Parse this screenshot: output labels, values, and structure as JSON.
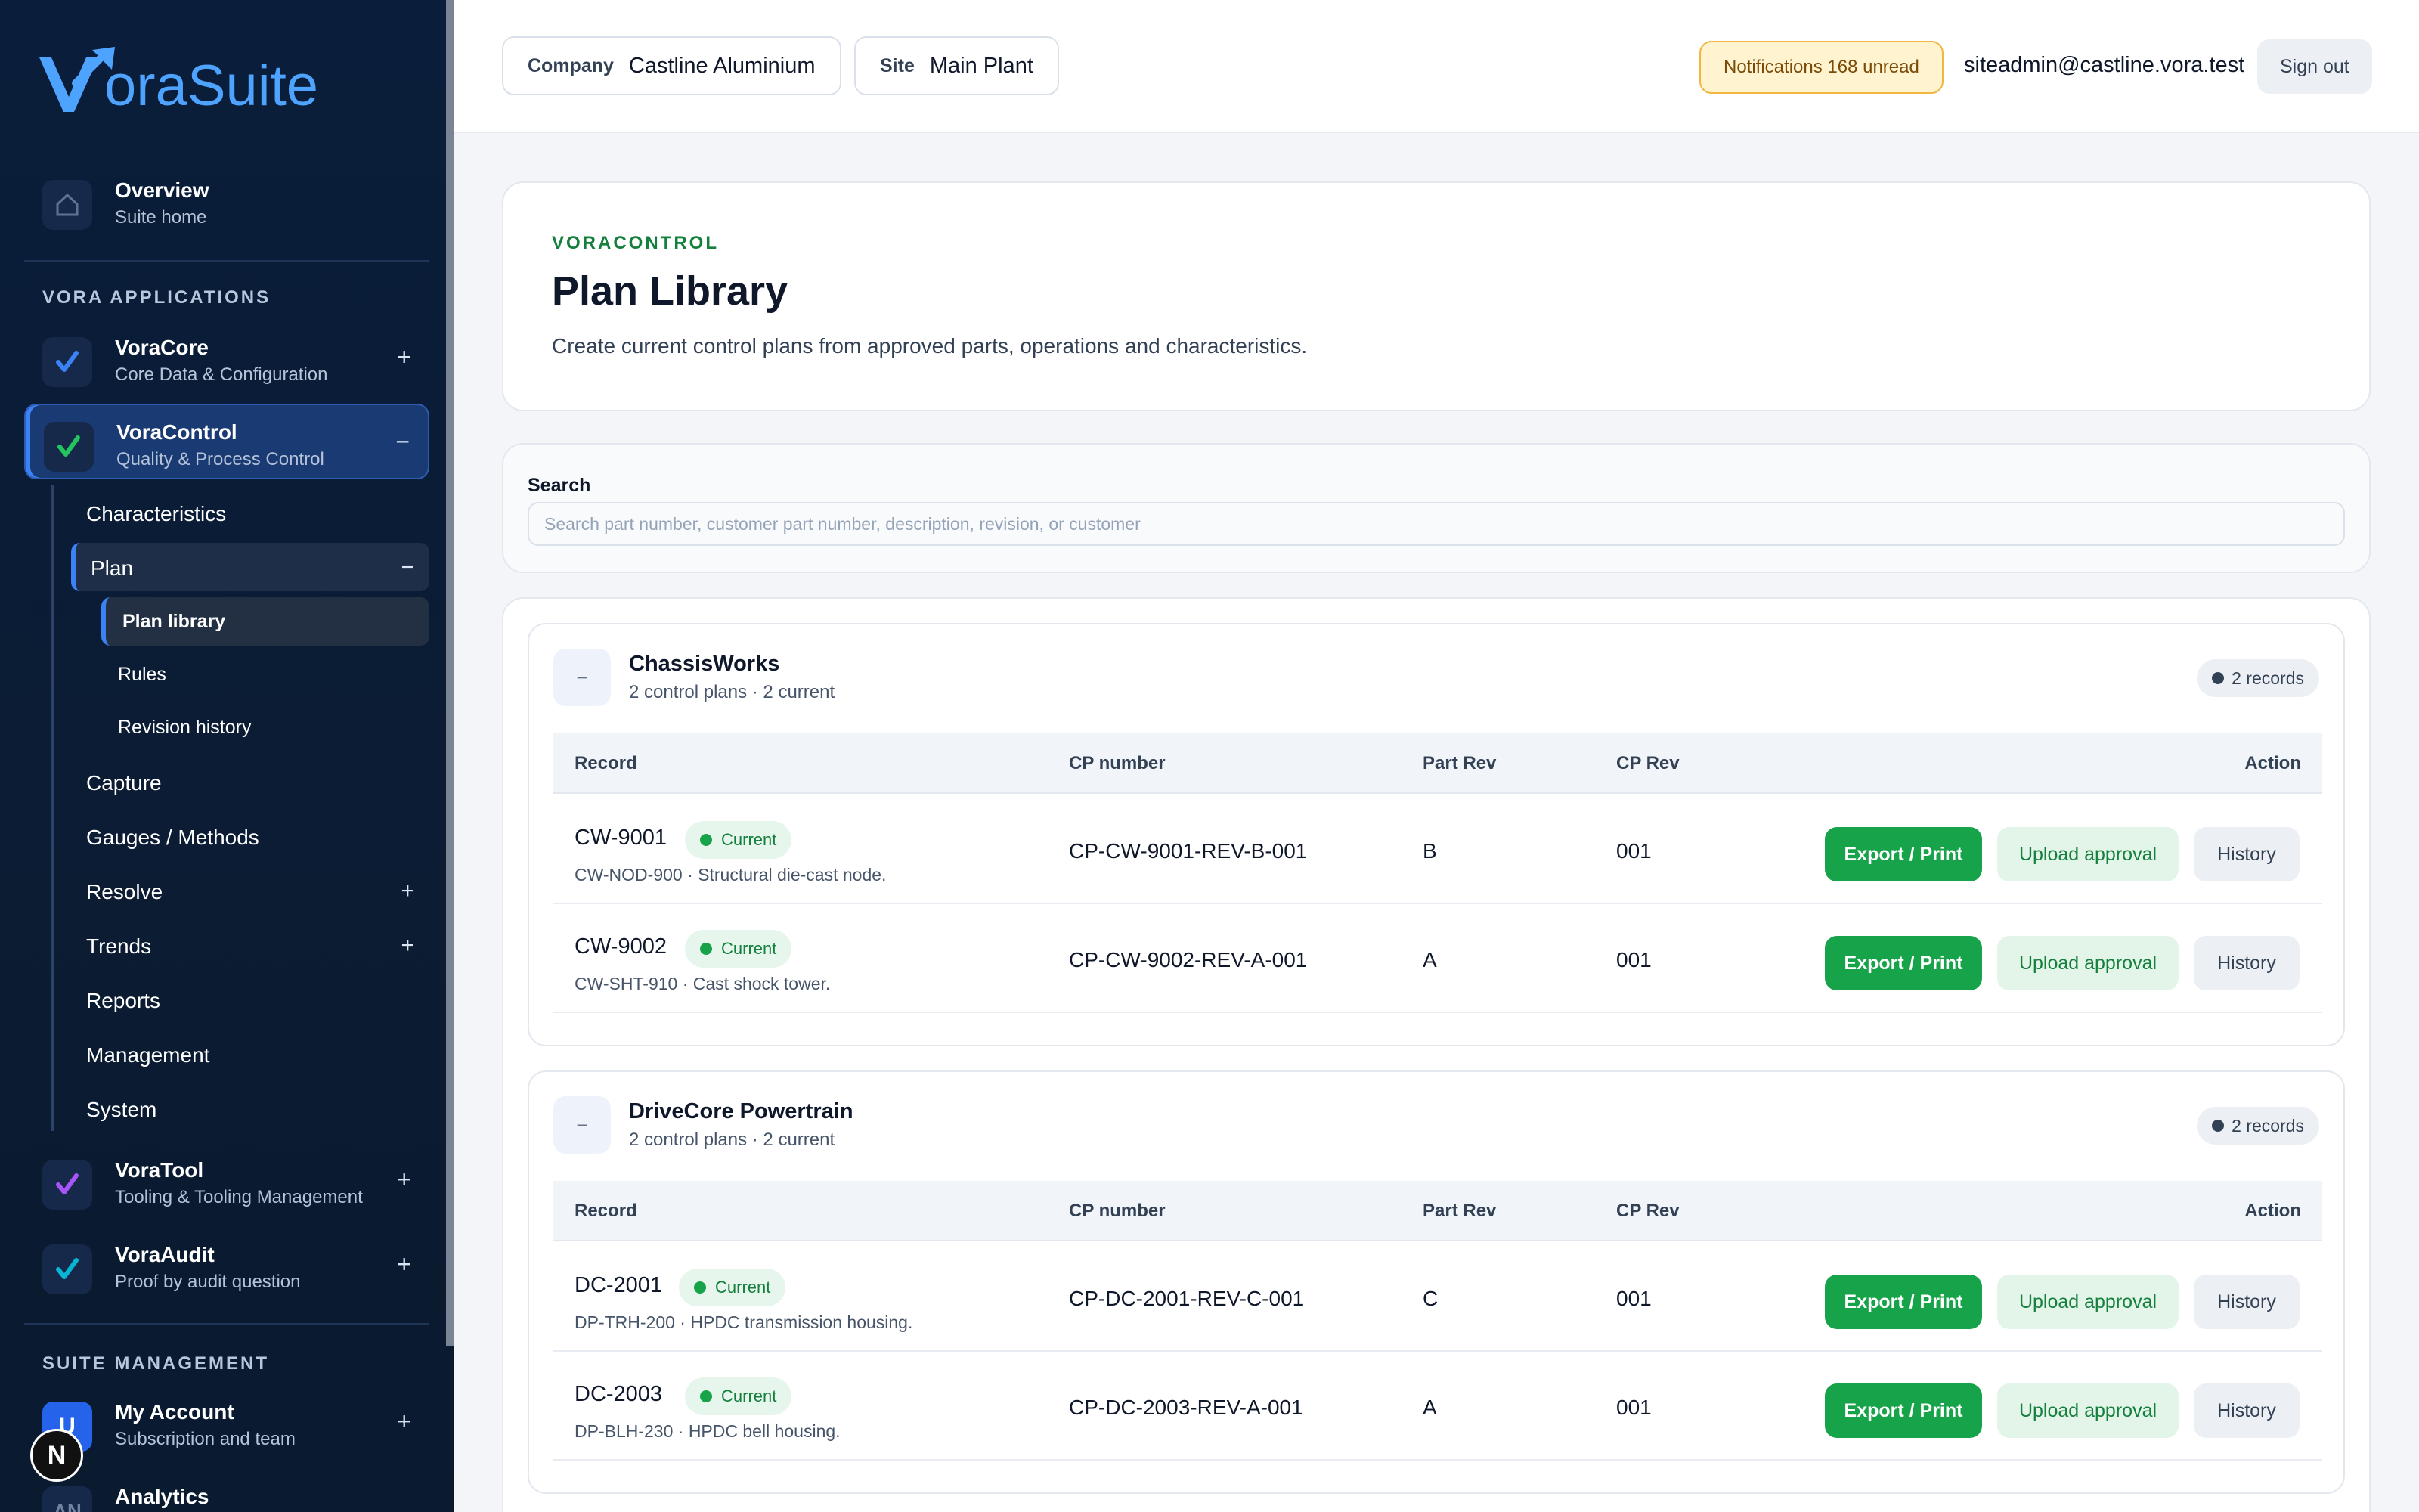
{
  "brand": {
    "name": "oraSuite",
    "full_name": "VoraSuite",
    "accent": "#4ea3ff"
  },
  "sidebar": {
    "overview": {
      "title": "Overview",
      "subtitle": "Suite home"
    },
    "apps_label": "VORA APPLICATIONS",
    "apps": [
      {
        "title": "VoraCore",
        "subtitle": "Core Data & Configuration",
        "toggle": "+",
        "color": "#3b82f6"
      },
      {
        "title": "VoraControl",
        "subtitle": "Quality & Process Control",
        "toggle": "−",
        "color": "#22c55e"
      },
      {
        "title": "VoraTool",
        "subtitle": "Tooling & Tooling Management",
        "toggle": "+",
        "color": "#a855f7"
      },
      {
        "title": "VoraAudit",
        "subtitle": "Proof by audit question",
        "toggle": "+",
        "color": "#06b6d4"
      }
    ],
    "control_items": [
      {
        "label": "Characteristics",
        "toggle": ""
      },
      {
        "label": "Plan",
        "toggle": "−"
      },
      {
        "label": "Capture",
        "toggle": ""
      },
      {
        "label": "Gauges / Methods",
        "toggle": ""
      },
      {
        "label": "Resolve",
        "toggle": "+"
      },
      {
        "label": "Trends",
        "toggle": "+"
      },
      {
        "label": "Reports",
        "toggle": ""
      },
      {
        "label": "Management",
        "toggle": ""
      },
      {
        "label": "System",
        "toggle": ""
      }
    ],
    "plan_items": [
      {
        "label": "Plan library"
      },
      {
        "label": "Rules"
      },
      {
        "label": "Revision history"
      }
    ],
    "suite_label": "SUITE MANAGEMENT",
    "suite": [
      {
        "title": "My Account",
        "subtitle": "Subscription and team",
        "toggle": "+",
        "initial": "U"
      },
      {
        "title": "Analytics",
        "subtitle": "",
        "toggle": "",
        "initial": "AN"
      }
    ],
    "bottom_badge": "N"
  },
  "topbar": {
    "company_label": "Company",
    "company_value": "Castline Aluminium",
    "site_label": "Site",
    "site_value": "Main Plant",
    "notifications": "Notifications 168 unread",
    "email": "siteadmin@castline.vora.test",
    "sign_out": "Sign out"
  },
  "header": {
    "eyebrow": "VORACONTROL",
    "title": "Plan Library",
    "description": "Create current control plans from approved parts, operations and characteristics."
  },
  "search": {
    "label": "Search",
    "placeholder": "Search part number, customer part number, description, revision, or customer",
    "value": ""
  },
  "table_headers": {
    "record": "Record",
    "cp_number": "CP number",
    "part_rev": "Part Rev",
    "cp_rev": "CP Rev",
    "action": "Action"
  },
  "actions": {
    "export": "Export / Print",
    "upload": "Upload approval",
    "history": "History"
  },
  "groups": [
    {
      "name": "ChassisWorks",
      "summary": "2 control plans · 2 current",
      "badge": "2 records",
      "collapse": "−",
      "rows": [
        {
          "id": "CW-9001",
          "status": "Current",
          "desc": "CW-NOD-900 · Structural die-cast node.",
          "cp": "CP-CW-9001-REV-B-001",
          "part_rev": "B",
          "cp_rev": "001"
        },
        {
          "id": "CW-9002",
          "status": "Current",
          "desc": "CW-SHT-910 · Cast shock tower.",
          "cp": "CP-CW-9002-REV-A-001",
          "part_rev": "A",
          "cp_rev": "001"
        }
      ]
    },
    {
      "name": "DriveCore Powertrain",
      "summary": "2 control plans · 2 current",
      "badge": "2 records",
      "collapse": "−",
      "rows": [
        {
          "id": "DC-2001",
          "status": "Current",
          "desc": "DP-TRH-200 · HPDC transmission housing.",
          "cp": "CP-DC-2001-REV-C-001",
          "part_rev": "C",
          "cp_rev": "001"
        },
        {
          "id": "DC-2003",
          "status": "Current",
          "desc": "DP-BLH-230 · HPDC bell housing.",
          "cp": "CP-DC-2003-REV-A-001",
          "part_rev": "A",
          "cp_rev": "001"
        }
      ]
    }
  ]
}
